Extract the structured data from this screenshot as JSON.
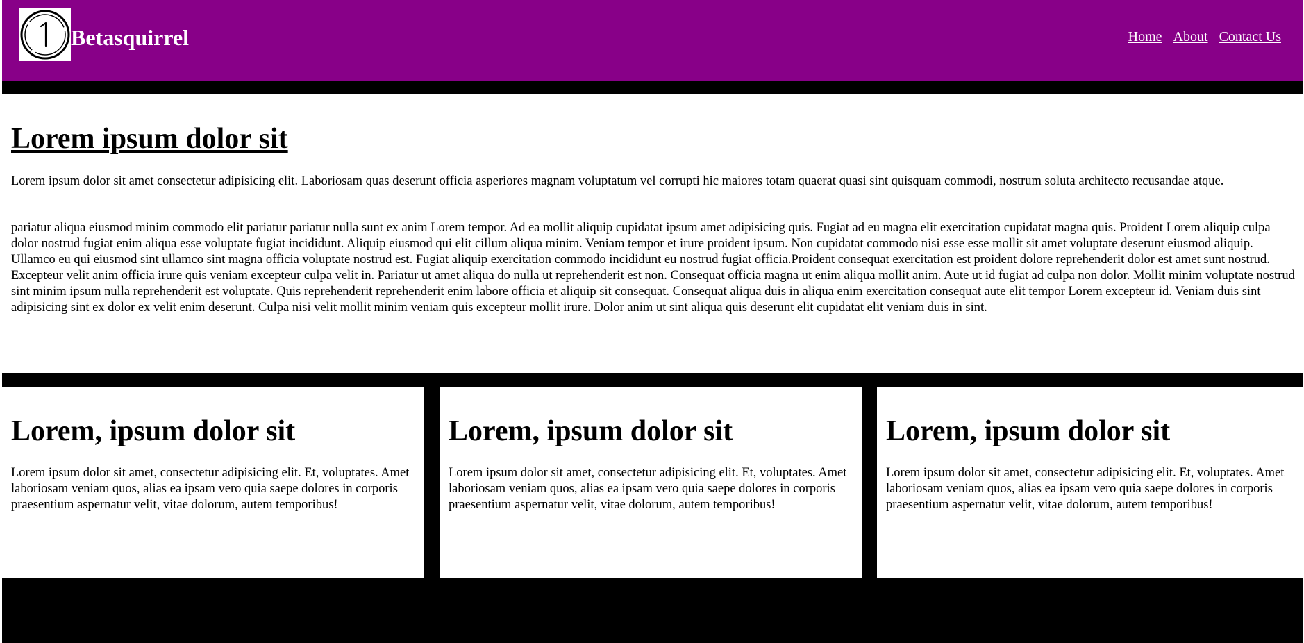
{
  "header": {
    "brand": "Betasquirrel",
    "logo_icon": "number-one-circle-logo",
    "background": "#880088",
    "nav": [
      "Home",
      "About",
      "Contact Us"
    ]
  },
  "intro": {
    "title": "Lorem ipsum dolor sit",
    "paragraphs": [
      "Lorem ipsum dolor sit amet consectetur adipisicing elit. Laboriosam quas deserunt officia asperiores magnam voluptatum vel corrupti hic maiores totam quaerat quasi sint quisquam commodi, nostrum soluta architecto recusandae atque.",
      "pariatur aliqua eiusmod minim commodo elit pariatur pariatur nulla sunt ex anim Lorem tempor. Ad ea mollit aliquip cupidatat ipsum amet adipisicing quis. Fugiat ad eu magna elit exercitation cupidatat magna quis. Proident Lorem aliquip culpa dolor nostrud fugiat enim aliqua esse voluptate fugiat incididunt. Aliquip eiusmod qui elit cillum aliqua minim. Veniam tempor et irure proident ipsum. Non cupidatat commodo nisi esse esse mollit sit amet voluptate deserunt eiusmod aliquip. Ullamco eu qui eiusmod sint ullamco sint magna officia voluptate nostrud est. Fugiat aliquip exercitation commodo incididunt eu nostrud fugiat officia.Proident consequat exercitation est proident dolore reprehenderit dolor est amet sunt nostrud. Excepteur velit anim officia irure quis veniam excepteur culpa velit in. Pariatur ut amet aliqua do nulla ut reprehenderit est non. Consequat officia magna ut enim aliqua mollit anim. Aute ut id fugiat ad culpa non dolor. Mollit minim voluptate nostrud sint minim ipsum nulla reprehenderit est voluptate. Quis reprehenderit reprehenderit enim labore officia et aliquip sit consequat. Consequat aliqua duis in aliqua enim exercitation consequat aute elit tempor Lorem excepteur id. Veniam duis sint adipisicing sint ex dolor ex velit enim deserunt. Culpa nisi velit mollit minim veniam quis excepteur mollit irure. Dolor anim ut sint aliqua quis deserunt elit cupidatat elit veniam duis in sint."
    ]
  },
  "cards": [
    {
      "title": "Lorem, ipsum dolor sit",
      "text": "Lorem ipsum dolor sit amet, consectetur adipisicing elit. Et, voluptates. Amet laboriosam veniam quos, alias ea ipsam vero quia saepe dolores in corporis praesentium aspernatur velit, vitae dolorum, autem temporibus!"
    },
    {
      "title": "Lorem, ipsum dolor sit",
      "text": "Lorem ipsum dolor sit amet, consectetur adipisicing elit. Et, voluptates. Amet laboriosam veniam quos, alias ea ipsam vero quia saepe dolores in corporis praesentium aspernatur velit, vitae dolorum, autem temporibus!"
    },
    {
      "title": "Lorem, ipsum dolor sit",
      "text": "Lorem ipsum dolor sit amet, consectetur adipisicing elit. Et, voluptates. Amet laboriosam veniam quos, alias ea ipsam vero quia saepe dolores in corporis praesentium aspernatur velit, vitae dolorum, autem temporibus!"
    }
  ]
}
